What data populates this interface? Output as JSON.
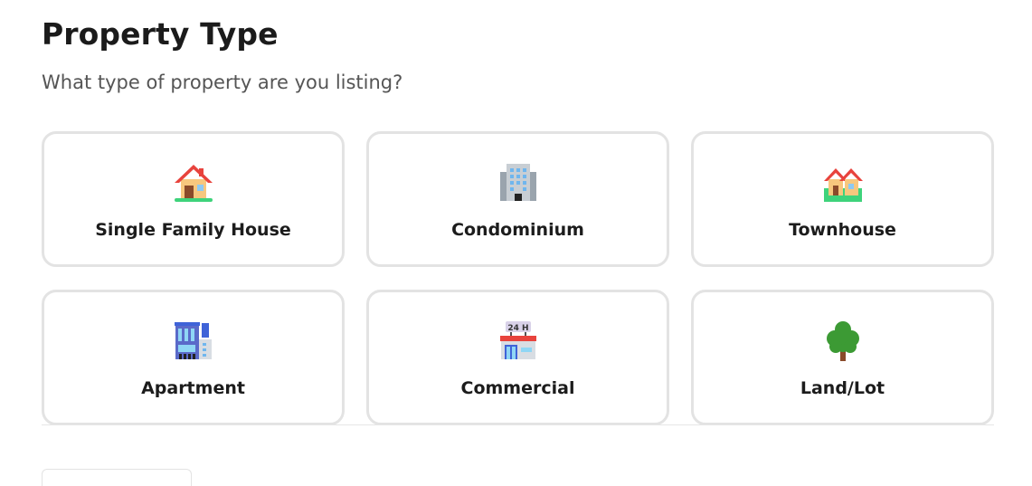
{
  "header": {
    "title": "Property Type",
    "subtitle": "What type of property are you listing?"
  },
  "options": [
    {
      "label": "Single Family House",
      "icon": "house-icon"
    },
    {
      "label": "Condominium",
      "icon": "office-building-icon"
    },
    {
      "label": "Townhouse",
      "icon": "houses-icon"
    },
    {
      "label": "Apartment",
      "icon": "apartment-building-icon"
    },
    {
      "label": "Commercial",
      "icon": "convenience-store-icon"
    },
    {
      "label": "Land/Lot",
      "icon": "tree-icon"
    }
  ],
  "footer": {
    "back_button_label": ""
  }
}
